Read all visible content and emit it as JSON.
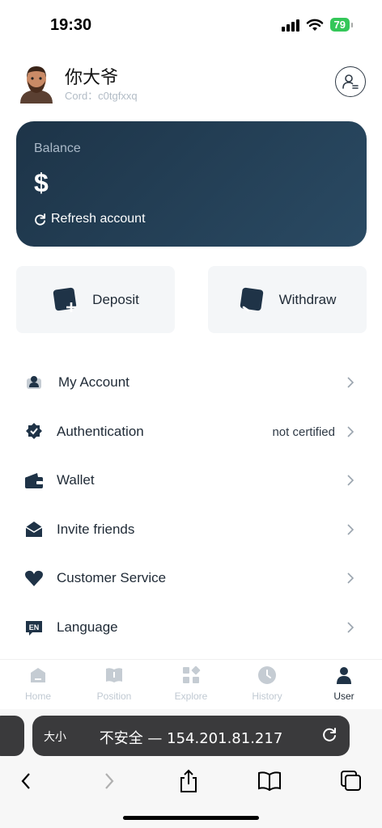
{
  "status": {
    "time": "19:30",
    "battery": "79"
  },
  "profile": {
    "name": "你大爷",
    "cord": "Cord：c0tgfxxq"
  },
  "balance": {
    "label": "Balance",
    "value": "$",
    "refresh_label": "Refresh account"
  },
  "actions": {
    "deposit_label": "Deposit",
    "withdraw_label": "Withdraw"
  },
  "menu": {
    "items": [
      {
        "label": "My Account",
        "value": ""
      },
      {
        "label": "Authentication",
        "value": "not certified"
      },
      {
        "label": "Wallet",
        "value": ""
      },
      {
        "label": "Invite friends",
        "value": ""
      },
      {
        "label": "Customer Service",
        "value": ""
      },
      {
        "label": "Language",
        "value": ""
      }
    ],
    "language_icon_text": "EN"
  },
  "tabs": [
    {
      "label": "Home"
    },
    {
      "label": "Position"
    },
    {
      "label": "Explore"
    },
    {
      "label": "History"
    },
    {
      "label": "User"
    }
  ],
  "browser": {
    "text_size": "大小",
    "url": "不安全 — 154.201.81.217"
  },
  "colors": {
    "accent": "#1d3448",
    "inactive_tab": "#c0c9d2",
    "battery": "#34c759"
  }
}
